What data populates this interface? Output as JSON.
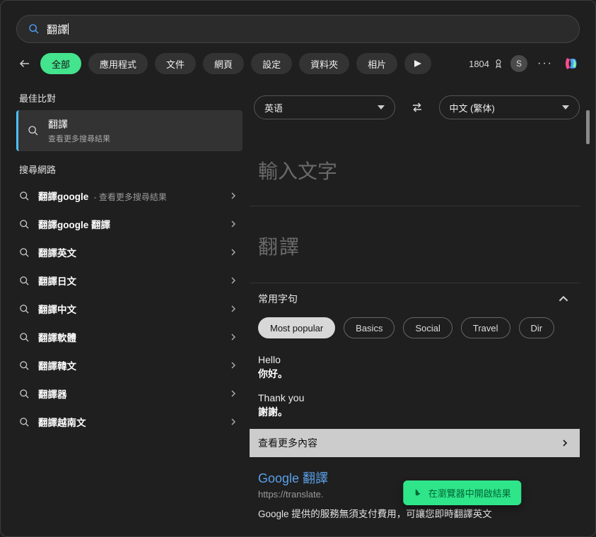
{
  "search": {
    "query": "翻譯"
  },
  "filters": {
    "tabs": [
      "全部",
      "應用程式",
      "文件",
      "網頁",
      "設定",
      "資料夾",
      "相片"
    ],
    "active_index": 0
  },
  "rewards": {
    "points": "1804",
    "s_label": "S"
  },
  "left": {
    "best_match_heading": "最佳比對",
    "best_match": {
      "title": "翻譯",
      "sub": "查看更多搜尋結果"
    },
    "search_web_heading": "搜尋網路",
    "web_items": [
      {
        "bold": "翻譯google",
        "sub": " - 查看更多搜尋結果"
      },
      {
        "bold": "翻譯google 翻譯",
        "sub": ""
      },
      {
        "bold": "翻譯英文",
        "sub": ""
      },
      {
        "bold": "翻譯日文",
        "sub": ""
      },
      {
        "bold": "翻譯中文",
        "sub": ""
      },
      {
        "bold": "翻譯軟體",
        "sub": ""
      },
      {
        "bold": "翻譯韓文",
        "sub": ""
      },
      {
        "bold": "翻譯器",
        "sub": ""
      },
      {
        "bold": "翻譯越南文",
        "sub": ""
      }
    ]
  },
  "right": {
    "lang_from": "英语",
    "lang_to": "中文 (繁体)",
    "input_placeholder": "輸入文字",
    "output_placeholder": "翻譯",
    "phrases_heading": "常用字句",
    "phrase_tabs": [
      "Most popular",
      "Basics",
      "Social",
      "Travel",
      "Dir"
    ],
    "phrase_active": 0,
    "sample_phrases": [
      {
        "en": "Hello",
        "zh": "你好。"
      },
      {
        "en": "Thank you",
        "zh": "謝謝。"
      }
    ],
    "see_more": "查看更多內容",
    "g_card": {
      "title": "Google 翻譯",
      "url": "https://translate.",
      "desc": "Google 提供的服務無須支付費用，可讓您即時翻譯英文"
    },
    "open_in_browser": "在瀏覽器中開啟結果"
  }
}
